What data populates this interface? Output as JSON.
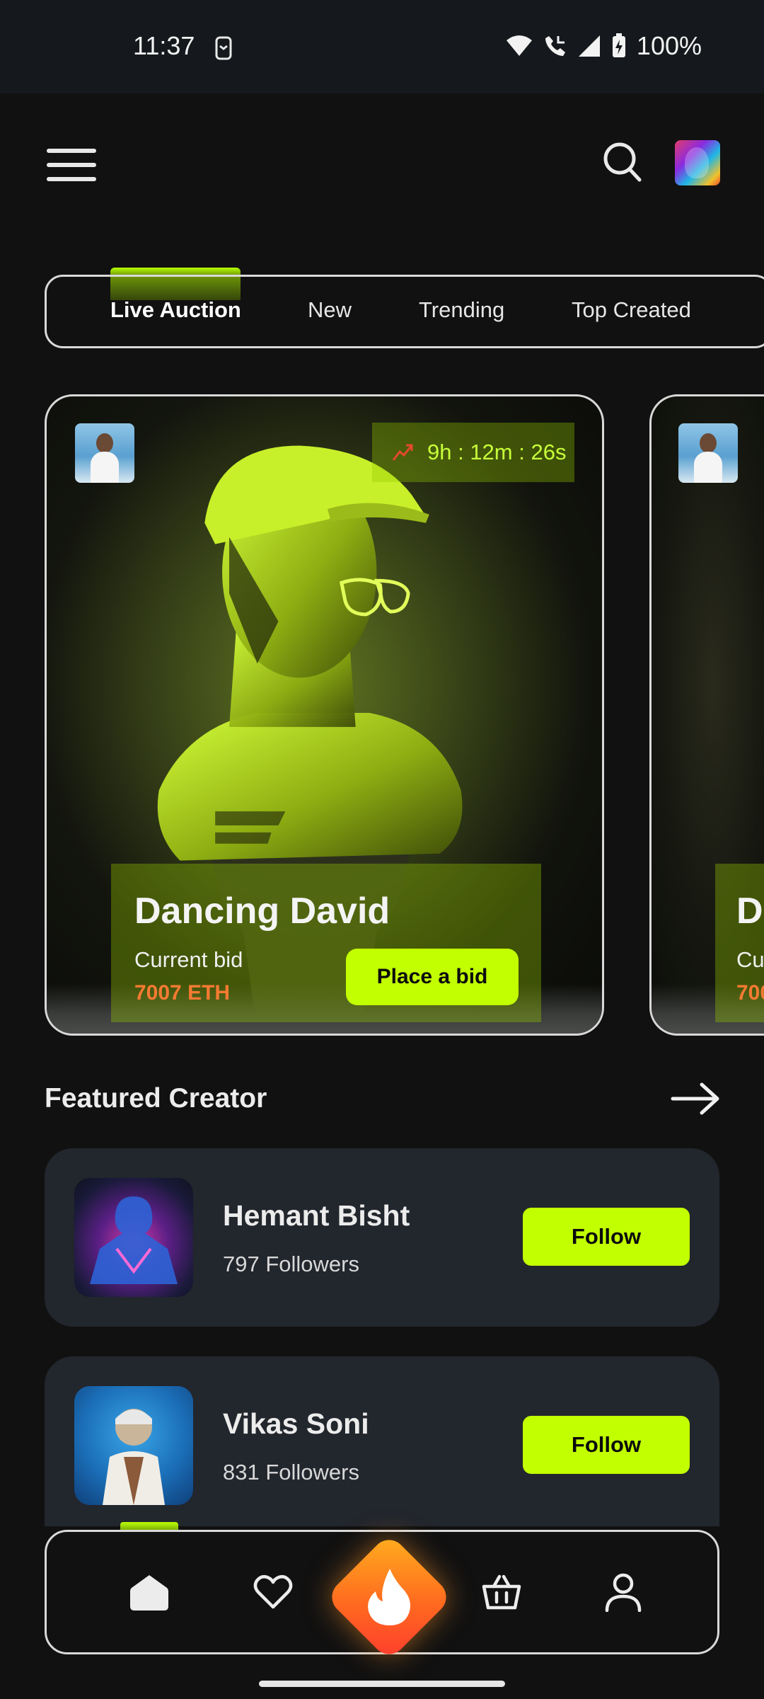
{
  "status_bar": {
    "time": "11:37",
    "battery": "100%"
  },
  "header": {
    "menu_icon": "hamburger-menu-icon",
    "search_icon": "search-icon",
    "avatar": "user-avatar"
  },
  "tabs": [
    {
      "label": "Live Auction",
      "active": true
    },
    {
      "label": "New",
      "active": false
    },
    {
      "label": "Trending",
      "active": false
    },
    {
      "label": "Top Created",
      "active": false
    }
  ],
  "auction": {
    "featured": {
      "timer": "9h : 12m : 26s",
      "title": "Dancing David",
      "bid_label": "Current bid",
      "bid_amount": "7007 ETH",
      "button_label": "Place a bid"
    },
    "next_peek": {
      "title": "D",
      "bid_label": "Cu",
      "bid_amount": "700"
    }
  },
  "featured_creator": {
    "title": "Featured Creator",
    "creators": [
      {
        "name": "Hemant Bisht",
        "followers": "797 Followers",
        "button_label": "Follow"
      },
      {
        "name": "Vikas Soni",
        "followers": "831 Followers",
        "button_label": "Follow"
      }
    ]
  },
  "bottom_nav": {
    "items": [
      "home-icon",
      "heart-icon",
      "fire-icon",
      "basket-icon",
      "profile-icon"
    ],
    "active": "home-icon"
  },
  "colors": {
    "background": "#111111",
    "accent": "#c2ff00",
    "bid_amount": "#f57a32",
    "card_surface": "#22262d",
    "fire_gradient_start": "#ffb11f",
    "fire_gradient_end": "#ff3b2f"
  }
}
